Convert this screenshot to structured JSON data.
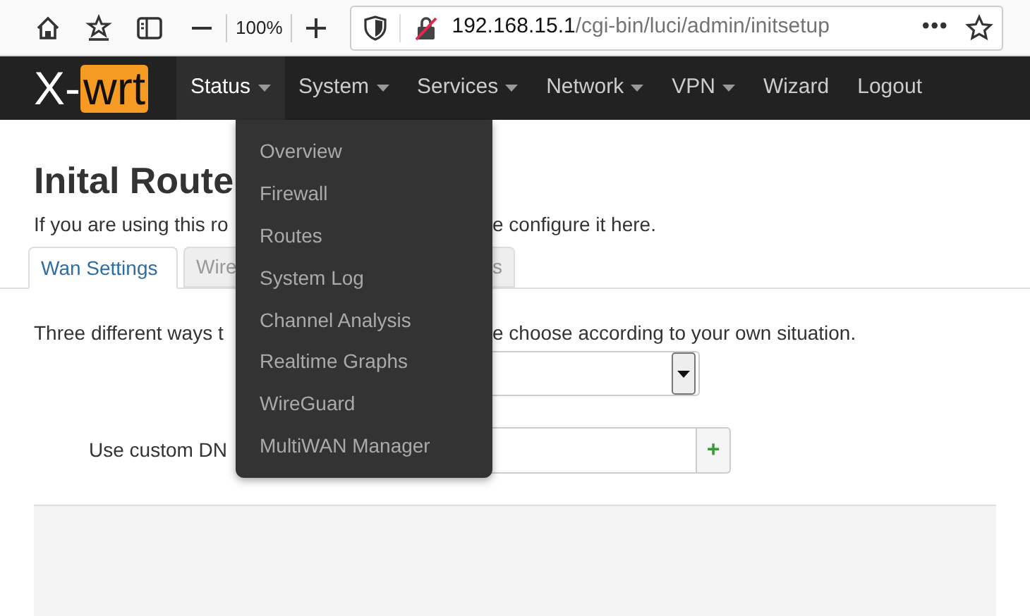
{
  "browser": {
    "zoom": "100%",
    "url_host": "192.168.15.1",
    "url_path": "/cgi-bin/luci/admin/initsetup",
    "more": "•••"
  },
  "nav": {
    "logo_left": "X-",
    "logo_right": "wrt",
    "items": [
      {
        "label": "Status",
        "dropdown": true,
        "selected": true
      },
      {
        "label": "System",
        "dropdown": true,
        "selected": false
      },
      {
        "label": "Services",
        "dropdown": true,
        "selected": false
      },
      {
        "label": "Network",
        "dropdown": true,
        "selected": false
      },
      {
        "label": "VPN",
        "dropdown": true,
        "selected": false
      },
      {
        "label": "Wizard",
        "dropdown": false,
        "selected": false
      },
      {
        "label": "Logout",
        "dropdown": false,
        "selected": false
      }
    ]
  },
  "menu": [
    "Overview",
    "Firewall",
    "Routes",
    "System Log",
    "Channel Analysis",
    "Realtime Graphs",
    "WireGuard",
    "MultiWAN Manager"
  ],
  "page": {
    "title": "Inital Route",
    "intro_left": "If you are using this ro",
    "intro_right": "e configure it here.",
    "tabs": [
      {
        "label": "Wan Settings",
        "selected": true
      },
      {
        "label": "Wire",
        "selected": false
      },
      {
        "label": "s",
        "selected": false
      }
    ],
    "hint_left": "Three different ways t",
    "hint_right": "e choose according to your own situation.",
    "dns_label": "Use custom DN",
    "add": "+"
  }
}
